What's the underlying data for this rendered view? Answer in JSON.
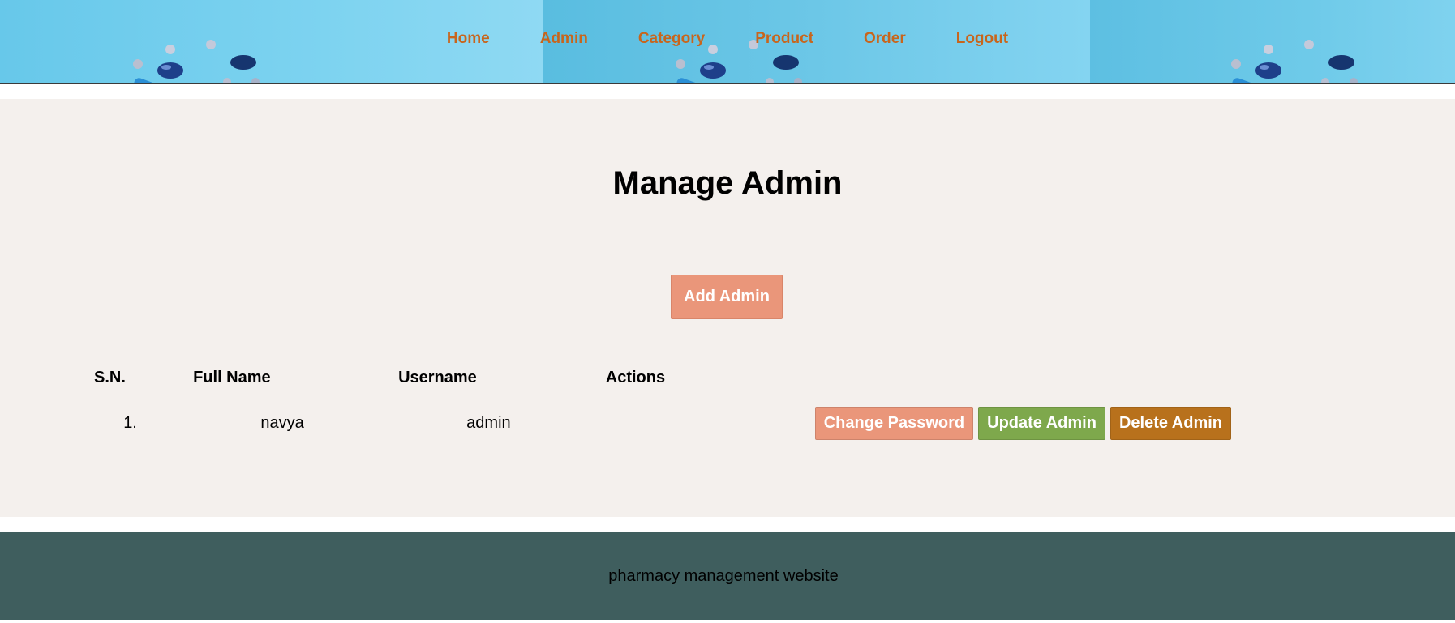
{
  "nav": {
    "items": [
      {
        "label": "Home"
      },
      {
        "label": "Admin"
      },
      {
        "label": "Category"
      },
      {
        "label": "Product"
      },
      {
        "label": "Order"
      },
      {
        "label": "Logout"
      }
    ]
  },
  "main": {
    "title": "Manage Admin",
    "add_button": "Add Admin"
  },
  "table": {
    "headers": [
      "S.N.",
      "Full Name",
      "Username",
      "Actions"
    ],
    "rows": [
      {
        "sn": "1.",
        "full_name": "navya",
        "username": "admin",
        "actions": {
          "change_password": "Change Password",
          "update": "Update Admin",
          "delete": "Delete Admin"
        }
      }
    ]
  },
  "footer": {
    "text": "pharmacy management website"
  },
  "colors": {
    "nav_link": "#c8651c",
    "main_bg": "#f4f0ed",
    "btn_salmon": "#ea967a",
    "btn_green": "#7ea84c",
    "btn_brown": "#b8711c",
    "footer_bg": "#3f5e5e"
  },
  "icons": {
    "banner": "medicine-pills-banner-image"
  }
}
